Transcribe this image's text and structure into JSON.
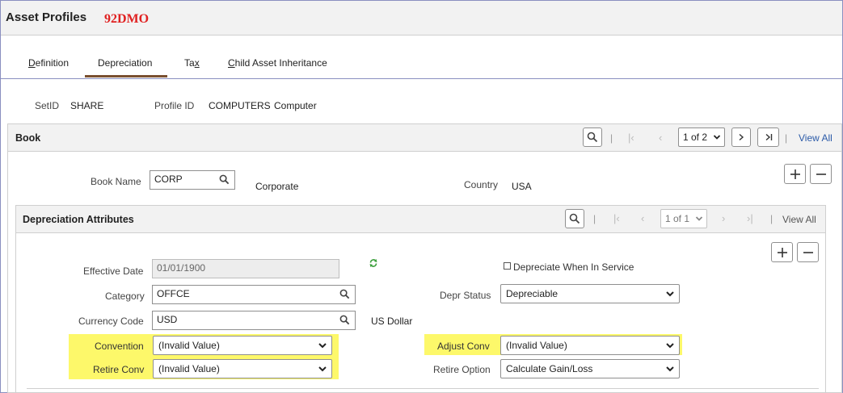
{
  "page": {
    "title": "Asset Profiles",
    "database": "92DMO"
  },
  "tabs": [
    {
      "label": "Definition",
      "active": false
    },
    {
      "label": "Depreciation",
      "active": true
    },
    {
      "label": "Tax",
      "active": false
    },
    {
      "label": "Child Asset Inheritance",
      "active": false
    }
  ],
  "header_fields": {
    "setid_label": "SetID",
    "setid_value": "SHARE",
    "profile_id_label": "Profile ID",
    "profile_id_value": "COMPUTERS",
    "profile_desc": "Computer"
  },
  "book_panel": {
    "title": "Book",
    "pager": "1 of 2",
    "view_all": "View All",
    "book_name_label": "Book Name",
    "book_name_value": "CORP",
    "book_desc": "Corporate",
    "country_label": "Country",
    "country_value": "USA"
  },
  "depr_panel": {
    "title": "Depreciation Attributes",
    "pager": "1 of 1",
    "view_all": "View All",
    "effective_date_label": "Effective Date",
    "effective_date_value": "01/01/1900",
    "depreciate_in_service_label": "Depreciate When In Service",
    "depreciate_in_service_checked": false,
    "category_label": "Category",
    "category_value": "OFFCE",
    "depr_status_label": "Depr Status",
    "depr_status_value": "Depreciable",
    "currency_code_label": "Currency Code",
    "currency_code_value": "USD",
    "currency_desc": "US Dollar",
    "convention_label": "Convention",
    "convention_value": "(Invalid Value)",
    "adjust_conv_label": "Adjust Conv",
    "adjust_conv_value": "(Invalid Value)",
    "retire_conv_label": "Retire Conv",
    "retire_conv_value": "(Invalid Value)",
    "retire_option_label": "Retire Option",
    "retire_option_value": "Calculate Gain/Loss"
  },
  "icons": {
    "search": "search-icon",
    "first": "first-page-icon",
    "prev": "previous-page-icon",
    "next": "next-page-icon",
    "last": "last-page-icon",
    "add": "plus-icon",
    "delete": "minus-icon",
    "refresh": "refresh-icon"
  },
  "colors": {
    "highlight": "#fdf86a",
    "database_name": "#e02020",
    "link": "#2b5aa8",
    "active_tab_underline": "#7a5030"
  }
}
